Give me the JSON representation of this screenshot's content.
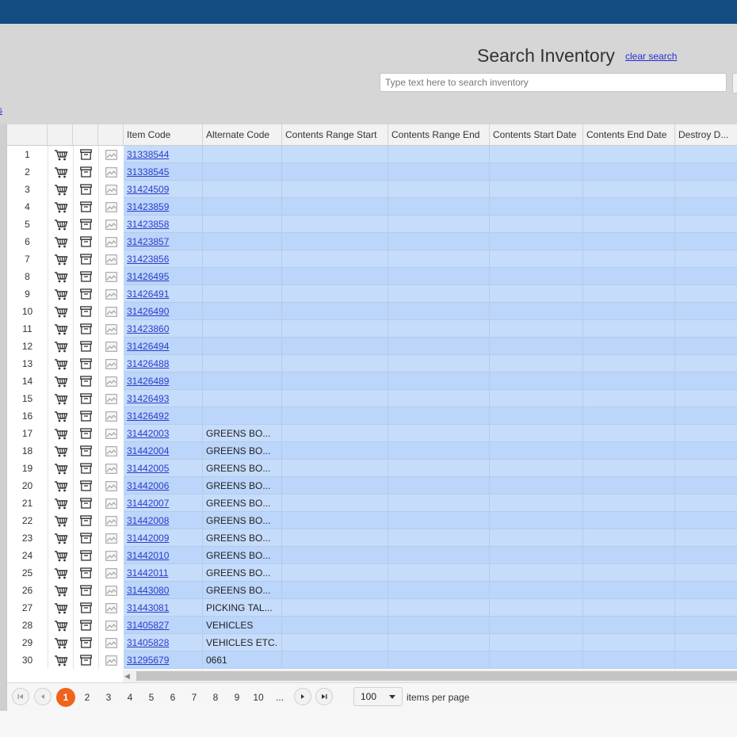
{
  "header": {
    "title": "Search Inventory",
    "clear_label": "clear search",
    "search_placeholder": "Type text here to search inventory",
    "left_link": "s"
  },
  "icons": {
    "cart": "cart-icon",
    "box": "archive-box-icon",
    "image": "image-icon"
  },
  "columns": [
    "Item Code",
    "Alternate Code",
    "Contents Range Start",
    "Contents Range End",
    "Contents Start Date",
    "Contents End Date",
    "Destroy D..."
  ],
  "rows": [
    {
      "n": "1",
      "code": "31338544",
      "alt": ""
    },
    {
      "n": "2",
      "code": "31338545",
      "alt": ""
    },
    {
      "n": "3",
      "code": "31424509",
      "alt": ""
    },
    {
      "n": "4",
      "code": "31423859",
      "alt": ""
    },
    {
      "n": "5",
      "code": "31423858",
      "alt": ""
    },
    {
      "n": "6",
      "code": "31423857",
      "alt": ""
    },
    {
      "n": "7",
      "code": "31423856",
      "alt": ""
    },
    {
      "n": "8",
      "code": "31426495",
      "alt": ""
    },
    {
      "n": "9",
      "code": "31426491",
      "alt": ""
    },
    {
      "n": "10",
      "code": "31426490",
      "alt": ""
    },
    {
      "n": "11",
      "code": "31423860",
      "alt": ""
    },
    {
      "n": "12",
      "code": "31426494",
      "alt": ""
    },
    {
      "n": "13",
      "code": "31426488",
      "alt": ""
    },
    {
      "n": "14",
      "code": "31426489",
      "alt": ""
    },
    {
      "n": "15",
      "code": "31426493",
      "alt": ""
    },
    {
      "n": "16",
      "code": "31426492",
      "alt": ""
    },
    {
      "n": "17",
      "code": "31442003",
      "alt": "GREENS BO..."
    },
    {
      "n": "18",
      "code": "31442004",
      "alt": "GREENS BO..."
    },
    {
      "n": "19",
      "code": "31442005",
      "alt": "GREENS BO..."
    },
    {
      "n": "20",
      "code": "31442006",
      "alt": "GREENS BO..."
    },
    {
      "n": "21",
      "code": "31442007",
      "alt": "GREENS BO..."
    },
    {
      "n": "22",
      "code": "31442008",
      "alt": "GREENS BO..."
    },
    {
      "n": "23",
      "code": "31442009",
      "alt": "GREENS BO..."
    },
    {
      "n": "24",
      "code": "31442010",
      "alt": "GREENS BO..."
    },
    {
      "n": "25",
      "code": "31442011",
      "alt": "GREENS BO..."
    },
    {
      "n": "26",
      "code": "31443080",
      "alt": "GREENS BO..."
    },
    {
      "n": "27",
      "code": "31443081",
      "alt": "PICKING TAL..."
    },
    {
      "n": "28",
      "code": "31405827",
      "alt": "VEHICLES"
    },
    {
      "n": "29",
      "code": "31405828",
      "alt": "VEHICLES ETC."
    },
    {
      "n": "30",
      "code": "31295679",
      "alt": "0661"
    }
  ],
  "pager": {
    "pages": [
      "1",
      "2",
      "3",
      "4",
      "5",
      "6",
      "7",
      "8",
      "9",
      "10",
      "..."
    ],
    "current": "1",
    "page_size": "100",
    "items_per_page_label": "items per page"
  }
}
